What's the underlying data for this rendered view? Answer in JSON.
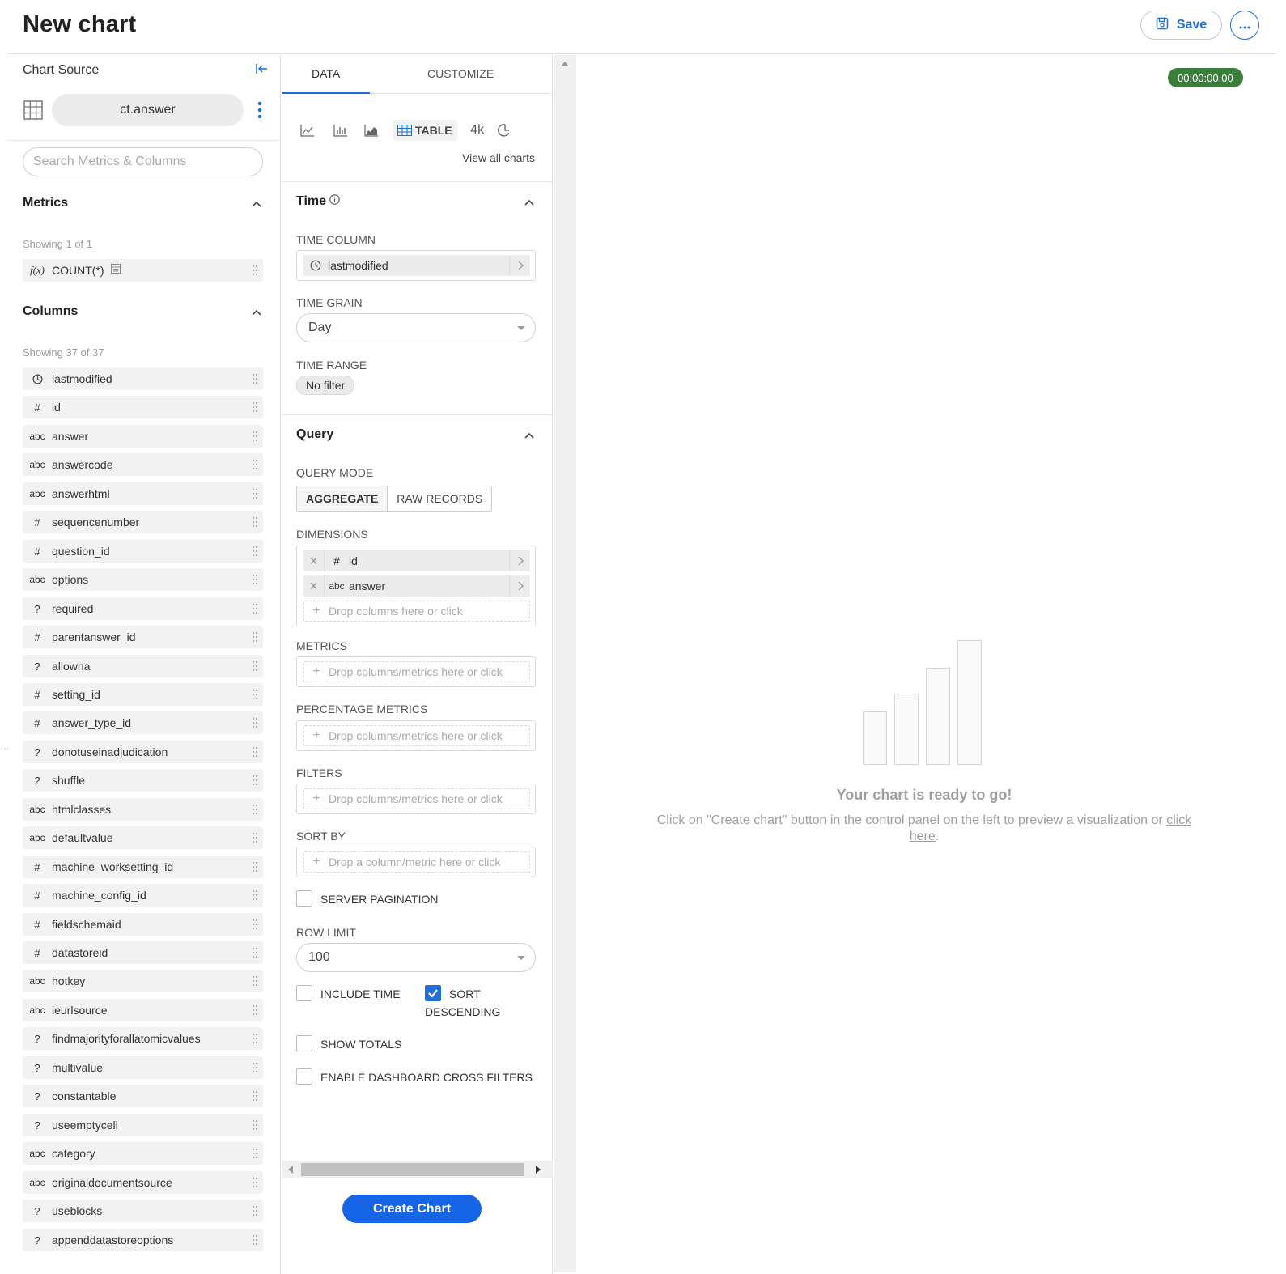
{
  "header": {
    "title": "New chart",
    "save_label": "Save"
  },
  "datasource": {
    "label": "Chart Source",
    "name": "ct.answer",
    "search_placeholder": "Search Metrics & Columns"
  },
  "metrics": {
    "title": "Metrics",
    "showing": "Showing 1 of 1",
    "items": [
      {
        "type": "f(x)",
        "name": "COUNT(*)"
      }
    ]
  },
  "columns": {
    "title": "Columns",
    "showing": "Showing 37 of 37",
    "items": [
      {
        "type": "time",
        "name": "lastmodified"
      },
      {
        "type": "#",
        "name": "id"
      },
      {
        "type": "abc",
        "name": "answer"
      },
      {
        "type": "abc",
        "name": "answercode"
      },
      {
        "type": "abc",
        "name": "answerhtml"
      },
      {
        "type": "#",
        "name": "sequencenumber"
      },
      {
        "type": "#",
        "name": "question_id"
      },
      {
        "type": "abc",
        "name": "options"
      },
      {
        "type": "?",
        "name": "required"
      },
      {
        "type": "#",
        "name": "parentanswer_id"
      },
      {
        "type": "?",
        "name": "allowna"
      },
      {
        "type": "#",
        "name": "setting_id"
      },
      {
        "type": "#",
        "name": "answer_type_id"
      },
      {
        "type": "?",
        "name": "donotuseinadjudication"
      },
      {
        "type": "?",
        "name": "shuffle"
      },
      {
        "type": "abc",
        "name": "htmlclasses"
      },
      {
        "type": "abc",
        "name": "defaultvalue"
      },
      {
        "type": "#",
        "name": "machine_worksetting_id"
      },
      {
        "type": "#",
        "name": "machine_config_id"
      },
      {
        "type": "#",
        "name": "fieldschemaid"
      },
      {
        "type": "#",
        "name": "datastoreid"
      },
      {
        "type": "abc",
        "name": "hotkey"
      },
      {
        "type": "abc",
        "name": "ieurlsource"
      },
      {
        "type": "?",
        "name": "findmajorityforallatomicvalues"
      },
      {
        "type": "?",
        "name": "multivalue"
      },
      {
        "type": "?",
        "name": "constantable"
      },
      {
        "type": "?",
        "name": "useemptycell"
      },
      {
        "type": "abc",
        "name": "category"
      },
      {
        "type": "abc",
        "name": "originaldocumentsource"
      },
      {
        "type": "?",
        "name": "useblocks"
      },
      {
        "type": "?",
        "name": "appenddatastoreoptions"
      }
    ]
  },
  "control": {
    "tabs": [
      "DATA",
      "CUSTOMIZE"
    ],
    "viz": {
      "table_label": "TABLE",
      "bignumber_label": "4k",
      "view_all": "View all charts"
    },
    "time": {
      "title": "Time",
      "column_label": "TIME COLUMN",
      "column_value": "lastmodified",
      "grain_label": "TIME GRAIN",
      "grain_value": "Day",
      "range_label": "TIME RANGE",
      "range_value": "No filter"
    },
    "query": {
      "title": "Query",
      "mode_label": "QUERY MODE",
      "mode_aggregate": "AGGREGATE",
      "mode_raw": "RAW RECORDS",
      "dimensions_label": "DIMENSIONS",
      "dimensions": [
        {
          "type": "#",
          "name": "id"
        },
        {
          "type": "abc",
          "name": "answer"
        }
      ],
      "dimensions_drop": "Drop columns here or click",
      "metrics_label": "METRICS",
      "metrics_drop": "Drop columns/metrics here or click",
      "pct_metrics_label": "PERCENTAGE METRICS",
      "pct_metrics_drop": "Drop columns/metrics here or click",
      "filters_label": "FILTERS",
      "filters_drop": "Drop columns/metrics here or click",
      "sortby_label": "SORT BY",
      "sortby_drop": "Drop a column/metric here or click",
      "server_pagination": "SERVER PAGINATION",
      "row_limit_label": "ROW LIMIT",
      "row_limit_value": "100",
      "include_time": "INCLUDE TIME",
      "sort_desc_1": "SORT",
      "sort_desc_2": "DESCENDING",
      "show_totals": "SHOW TOTALS",
      "cross_filters": "ENABLE DASHBOARD CROSS FILTERS"
    },
    "create_button": "Create Chart"
  },
  "chart_area": {
    "timer": "00:00:00.00",
    "empty_title": "Your chart is ready to go!",
    "empty_desc": "Click on \"Create chart\" button in the control panel on the left to preview a visualization or ",
    "empty_link": "click here",
    "empty_end": "."
  },
  "colors": {
    "accent": "#1f6fd6",
    "primary_button": "#1565e6",
    "timer_bg": "#3b7d3a"
  }
}
